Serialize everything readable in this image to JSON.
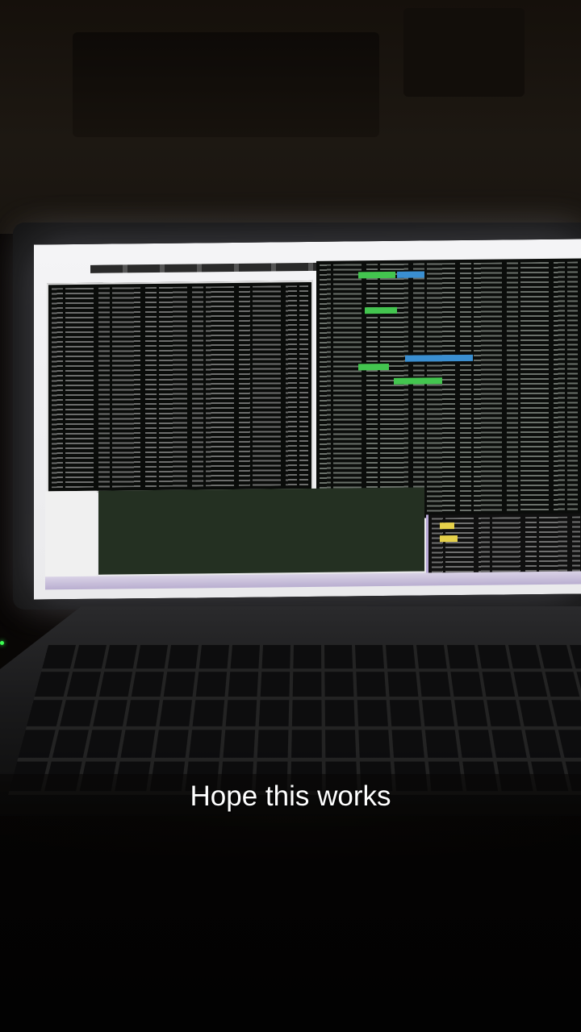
{
  "caption": {
    "text": "Hope this works"
  },
  "colors": {
    "caption_text": "#ffffff",
    "status_led": "#3cff52",
    "screen_glow": "#f4f4f6",
    "terminal_bg": "#0a0c0a",
    "highlight_green": "#43c54f",
    "highlight_blue": "#3a8fd1",
    "highlight_yellow": "#e6d14a",
    "taskbar": "#b9aed0"
  },
  "icons": {
    "status_led": "power-led-icon"
  }
}
